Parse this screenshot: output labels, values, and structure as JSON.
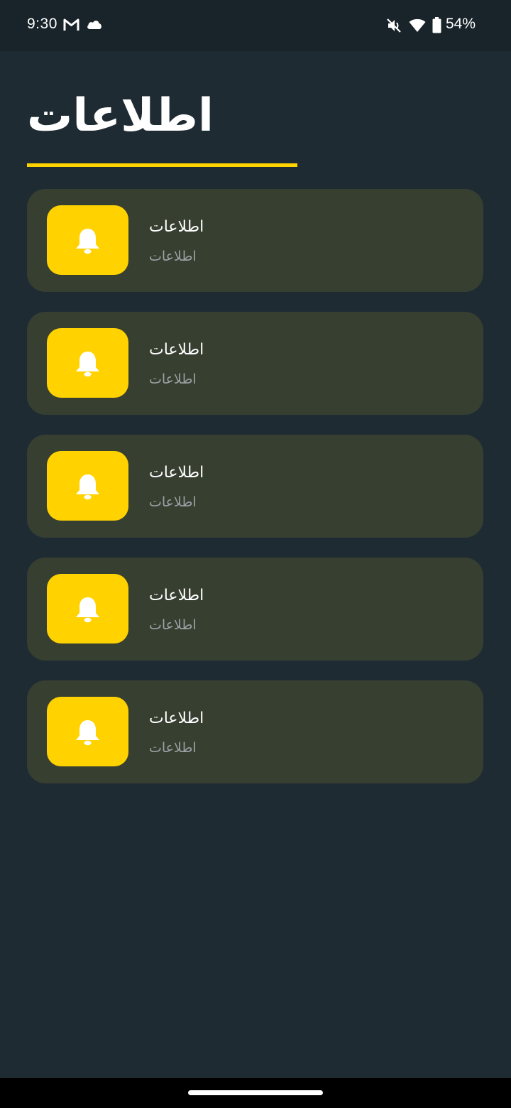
{
  "status_bar": {
    "time": "9:30",
    "battery": "54%",
    "icons": [
      "gmail-icon",
      "cloud-icon",
      "mute-icon",
      "wifi-icon",
      "battery-icon"
    ]
  },
  "header": {
    "title": "اطلاعات"
  },
  "notifications": [
    {
      "title": "اطلاعات",
      "subtitle": "اطلاعات",
      "icon": "bell-icon"
    },
    {
      "title": "اطلاعات",
      "subtitle": "اطلاعات",
      "icon": "bell-icon"
    },
    {
      "title": "اطلاعات",
      "subtitle": "اطلاعات",
      "icon": "bell-icon"
    },
    {
      "title": "اطلاعات",
      "subtitle": "اطلاعات",
      "icon": "bell-icon"
    },
    {
      "title": "اطلاعات",
      "subtitle": "اطلاعات",
      "icon": "bell-icon"
    }
  ],
  "colors": {
    "background": "#1f2b33",
    "card": "#373f31",
    "accent": "#ffd200",
    "subtitle": "#9aa0a3"
  }
}
